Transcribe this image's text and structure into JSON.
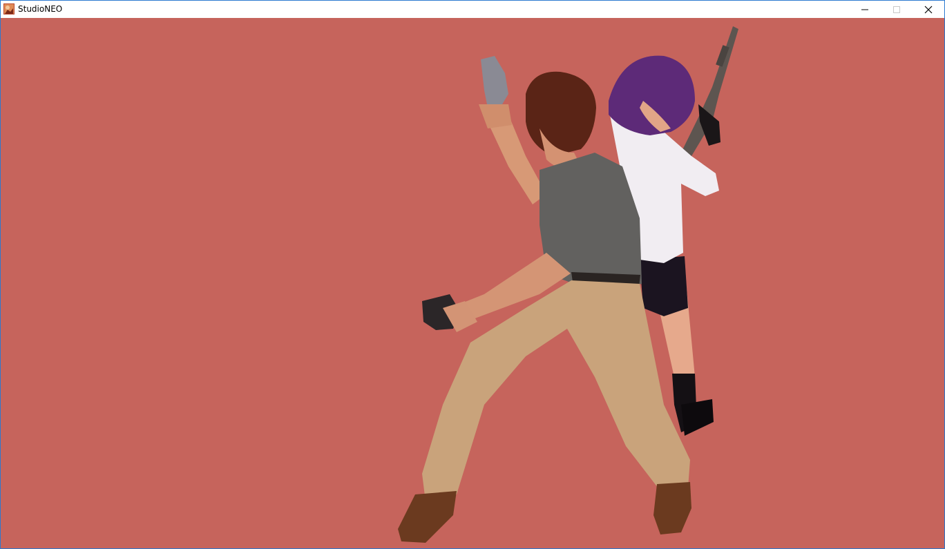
{
  "window": {
    "title": "StudioNEO",
    "icon": "studioneo-app-icon",
    "controls": {
      "minimize_icon": "minimize-icon",
      "maximize_icon": "maximize-icon",
      "close_icon": "close-icon"
    }
  },
  "viewport": {
    "background_color": "#c6645c",
    "scene": {
      "figures": [
        "man-with-revolvers",
        "woman-with-rifle"
      ]
    }
  }
}
